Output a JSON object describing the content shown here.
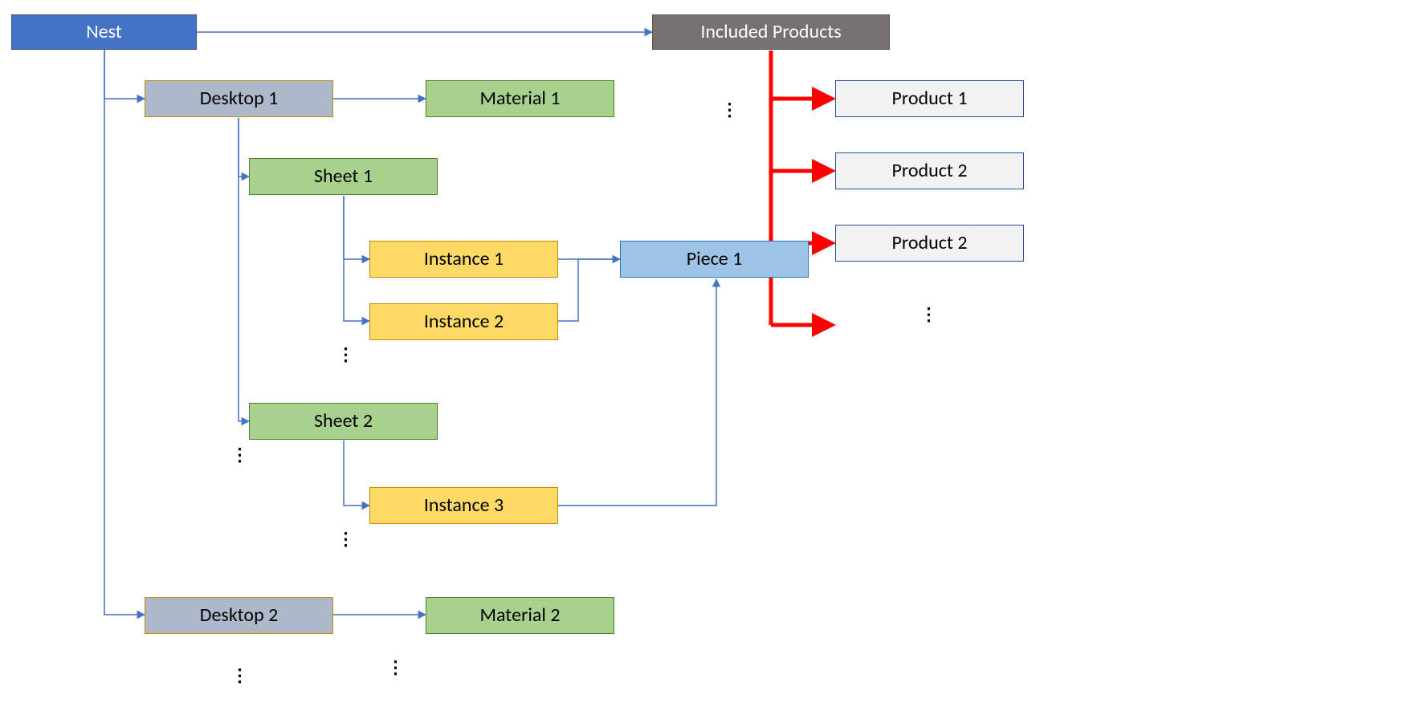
{
  "diagram": {
    "type": "hierarchy / ER diagram",
    "root": "Nest",
    "colors": {
      "root": "#4472C4",
      "included_products": "#767171",
      "desktop": "#ADB9CA",
      "material": "#A9D18E",
      "sheet": "#A9D18E",
      "instance": "#FFD966",
      "piece": "#9DC3E6",
      "product": "#F2F2F2",
      "accent_arrows": "#FF0000",
      "normal_arrows": "#4472C4"
    }
  },
  "nodes": {
    "nest": "Nest",
    "included_products": "Included Products",
    "desktop1": "Desktop 1",
    "material1": "Material 1",
    "sheet1": "Sheet 1",
    "instance1": "Instance 1",
    "instance2": "Instance 2",
    "sheet2": "Sheet 2",
    "instance3": "Instance 3",
    "piece1": "Piece 1",
    "desktop2": "Desktop 2",
    "material2": "Material 2",
    "product1": "Product 1",
    "product2a": "Product 2",
    "product2b": "Product 2"
  },
  "ellipses": "…",
  "edges_blue": [
    {
      "from": "nest",
      "to": "included_products"
    },
    {
      "from": "nest",
      "to": "desktop1"
    },
    {
      "from": "nest",
      "to": "desktop2"
    },
    {
      "from": "desktop1",
      "to": "material1"
    },
    {
      "from": "desktop1",
      "to": "sheet1"
    },
    {
      "from": "desktop1",
      "to": "sheet2"
    },
    {
      "from": "sheet1",
      "to": "instance1"
    },
    {
      "from": "sheet1",
      "to": "instance2"
    },
    {
      "from": "sheet2",
      "to": "instance3"
    },
    {
      "from": "desktop2",
      "to": "material2"
    },
    {
      "from": "instance1",
      "to": "piece1"
    },
    {
      "from": "instance2",
      "to": "piece1"
    },
    {
      "from": "instance3",
      "to": "piece1"
    }
  ],
  "edges_red": [
    {
      "from": "included_products",
      "to": "product1"
    },
    {
      "from": "included_products",
      "to": "product2a"
    },
    {
      "from": "included_products",
      "to": "product2b"
    },
    {
      "from": "included_products",
      "to": "more"
    }
  ]
}
